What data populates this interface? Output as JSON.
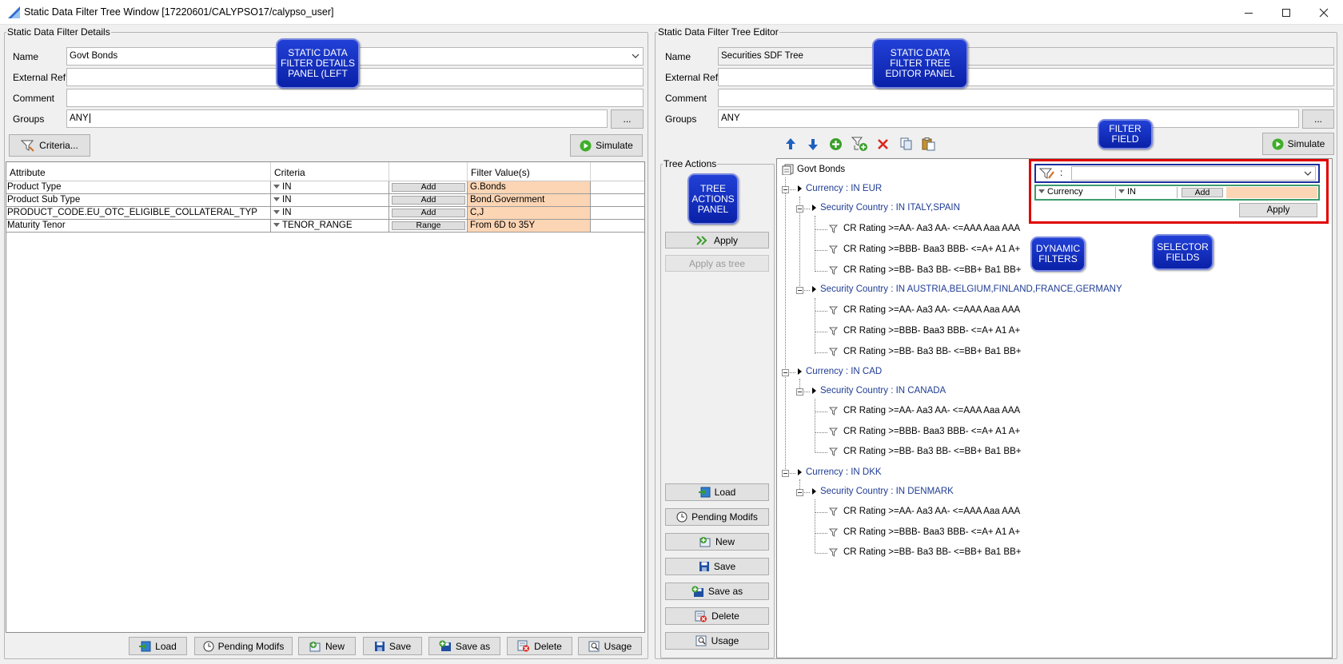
{
  "window": {
    "title": "Static Data Filter Tree Window  [17220601/CALYPSO17/calypso_user]"
  },
  "left": {
    "legend": "Static Data Filter Details",
    "name_label": "Name",
    "name_value": "Govt Bonds",
    "extref_label": "External Ref.",
    "extref_value": "",
    "comment_label": "Comment",
    "comment_value": "",
    "groups_label": "Groups",
    "groups_value": "ANY",
    "ellipsis": "...",
    "criteria_button": "Criteria...",
    "simulate_button": "Simulate",
    "table": {
      "headers": [
        "Attribute",
        "Criteria",
        "",
        "Filter Value(s)"
      ],
      "rows": [
        {
          "attribute": "Product Type",
          "criteria": "IN",
          "action": "Add",
          "value": "G.Bonds"
        },
        {
          "attribute": "Product Sub Type",
          "criteria": "IN",
          "action": "Add",
          "value": "Bond.Government"
        },
        {
          "attribute": "PRODUCT_CODE.EU_OTC_ELIGIBLE_COLLATERAL_TYP",
          "criteria": "IN",
          "action": "Add",
          "value": "C,J"
        },
        {
          "attribute": "Maturity Tenor",
          "criteria": "TENOR_RANGE",
          "action": "Range",
          "value": "From 6D to 35Y"
        }
      ]
    },
    "bottom_buttons": [
      "Load",
      "Pending Modifs",
      "New",
      "Save",
      "Save as",
      "Delete",
      "Usage"
    ]
  },
  "right": {
    "legend": "Static Data Filter Tree Editor",
    "name_label": "Name",
    "name_value": "Securities SDF Tree",
    "extref_label": "External Ref.",
    "extref_value": "",
    "comment_label": "Comment",
    "comment_value": "",
    "groups_label": "Groups",
    "groups_value": "ANY",
    "ellipsis": "...",
    "simulate_button": "Simulate",
    "toolbar_icons": [
      "move-up-icon",
      "move-down-icon",
      "add-node-icon",
      "add-child-icon",
      "delete-node-icon",
      "copy-icon",
      "paste-icon"
    ],
    "tree_actions": {
      "legend": "Tree Actions",
      "apply": "Apply",
      "apply_as_tree": "Apply as tree",
      "buttons": [
        "Load",
        "Pending Modifs",
        "New",
        "Save",
        "Save as",
        "Delete",
        "Usage"
      ]
    },
    "tree": {
      "root": "Govt Bonds",
      "currencies": [
        {
          "label": "Currency : IN EUR",
          "countries": [
            {
              "label": "Security Country : IN ITALY,SPAIN",
              "ratings": [
                "CR Rating >=AA- Aa3 AA- <=AAA Aaa AAA",
                "CR Rating >=BBB- Baa3 BBB- <=A+ A1 A+",
                "CR Rating >=BB- Ba3 BB- <=BB+ Ba1 BB+"
              ]
            },
            {
              "label": "Security Country : IN AUSTRIA,BELGIUM,FINLAND,FRANCE,GERMANY",
              "ratings": [
                "CR Rating >=AA- Aa3 AA- <=AAA Aaa AAA",
                "CR Rating >=BBB- Baa3 BBB- <=A+ A1 A+",
                "CR Rating >=BB- Ba3 BB- <=BB+ Ba1 BB+"
              ]
            }
          ]
        },
        {
          "label": "Currency : IN CAD",
          "countries": [
            {
              "label": "Security Country : IN CANADA",
              "ratings": [
                "CR Rating >=AA- Aa3 AA- <=AAA Aaa AAA",
                "CR Rating >=BBB- Baa3 BBB- <=A+ A1 A+",
                "CR Rating >=BB- Ba3 BB- <=BB+ Ba1 BB+"
              ]
            }
          ]
        },
        {
          "label": "Currency : IN DKK",
          "countries": [
            {
              "label": "Security Country : IN DENMARK",
              "ratings": [
                "CR Rating >=AA- Aa3 AA- <=AAA Aaa AAA",
                "CR Rating >=BBB- Baa3 BBB- <=A+ A1 A+",
                "CR Rating >=BB- Ba3 BB- <=BB+ Ba1 BB+"
              ]
            }
          ]
        }
      ]
    },
    "filter": {
      "colon": ":",
      "field_value": "",
      "attribute": "Currency",
      "criteria": "IN",
      "add": "Add",
      "apply": "Apply"
    }
  },
  "callouts": {
    "details_panel": "STATIC DATA FILTER DETAILS PANEL (LEFT",
    "tree_editor_panel": "STATIC DATA FILTER TREE EDITOR PANEL",
    "tree_actions_panel": "TREE ACTIONS PANEL",
    "filter_field": "FILTER FIELD",
    "dynamic_filters": "DYNAMIC FILTERS",
    "selector_fields": "SELECTOR FIELDS"
  },
  "colors": {
    "filter_value_bg": "#fcd5b4",
    "tree_link": "#1f3c93",
    "callout_blue": "#1430c4",
    "highlight_red": "#e00000",
    "filter_border_blue": "#1a2fa0",
    "selector_border_green": "#3c9c6c"
  }
}
